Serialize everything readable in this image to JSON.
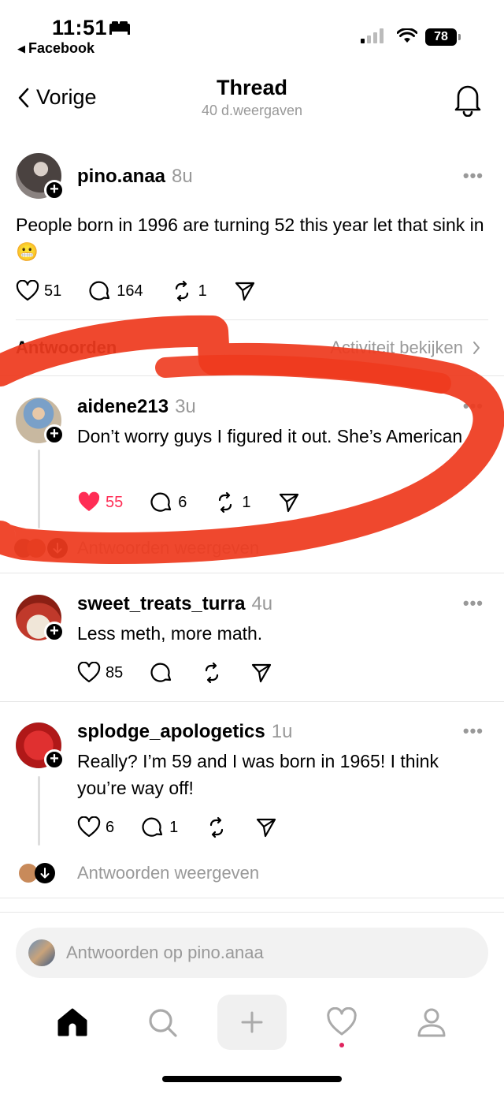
{
  "status_bar": {
    "time": "11:51",
    "back_app": "Facebook",
    "battery": "78"
  },
  "header": {
    "back_label": "Vorige",
    "title": "Thread",
    "subtitle": "40 d.weergaven"
  },
  "main_post": {
    "username": "pino.anaa",
    "time": "8u",
    "text": "People born in 1996 are turning 52 this year let that sink in 😬",
    "likes": "51",
    "replies": "164",
    "reposts": "1"
  },
  "section": {
    "replies_label": "Antwoorden",
    "activity_link": "Activiteit bekijken"
  },
  "replies": [
    {
      "username": "aidene213",
      "time": "3u",
      "text": "Don’t worry guys I figured it out. She’s American",
      "likes": "55",
      "liked": true,
      "replies": "6",
      "reposts": "1",
      "view_replies": "Antwoorden weergeven"
    },
    {
      "username": "sweet_treats_turra",
      "time": "4u",
      "text": "Less meth, more math.",
      "likes": "85",
      "replies": "",
      "reposts": ""
    },
    {
      "username": "splodge_apologetics",
      "time": "1u",
      "text": "Really? I’m 59 and I was born in 1965! I think you’re way off!",
      "likes": "6",
      "replies": "1",
      "reposts": "",
      "view_replies": "Antwoorden weergeven"
    }
  ],
  "reply_bar": {
    "placeholder": "Antwoorden op pino.anaa"
  },
  "tabs": [
    "home-icon",
    "search-icon",
    "create-icon",
    "activity-icon",
    "profile-icon"
  ],
  "colors": {
    "like_red": "#ff2d55",
    "annotation_red": "#ee3a1e",
    "muted_gray": "#999999"
  }
}
